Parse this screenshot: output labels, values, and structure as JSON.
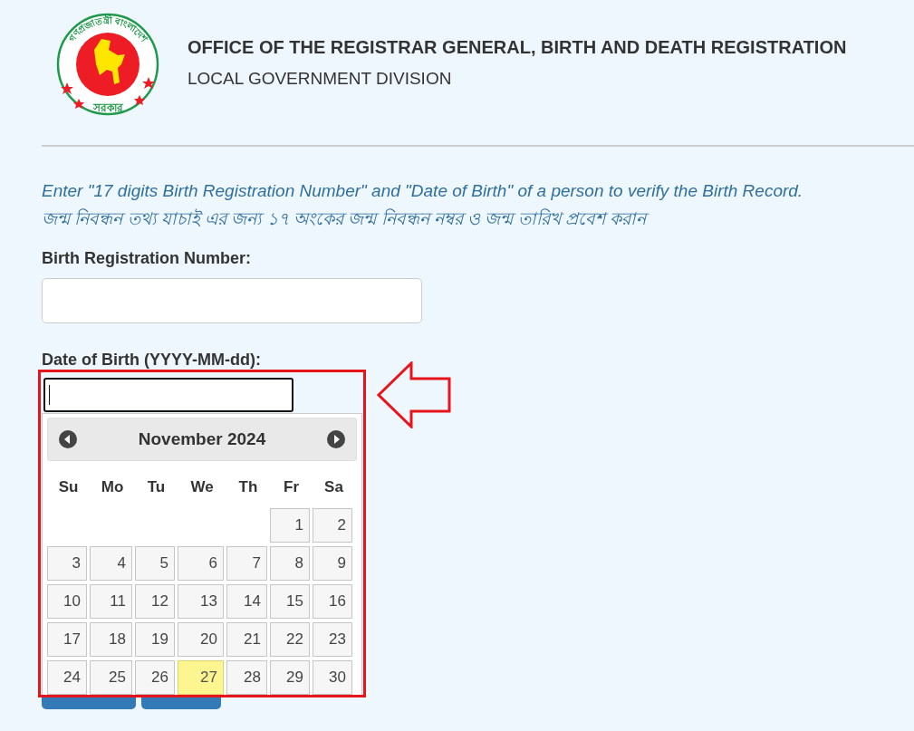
{
  "logo": {
    "top_text": "গণপ্রজাতন্ত্রী বাংলাদেশ",
    "bottom_text": "সরকার"
  },
  "header": {
    "title": "OFFICE OF THE REGISTRAR GENERAL, BIRTH AND DEATH REGISTRATION",
    "subtitle": "LOCAL GOVERNMENT DIVISION"
  },
  "instructions": [
    "Enter \"17 digits Birth Registration Number\" and \"Date of Birth\" of a person to verify the Birth Record.",
    "জন্ম নিবন্ধন তথ্য যাচাই এর জন্য ১৭ অংকের জন্ম নিবন্ধন নম্বর ও জন্ম তারিখ প্রবেশ করান"
  ],
  "fields": [
    {
      "label": "Birth Registration Number:"
    },
    {
      "label": "Date of Birth (YYYY-MM-dd):",
      "focused": true
    }
  ],
  "datepicker": {
    "month_label": "November 2024",
    "weekdays": [
      "Su",
      "Mo",
      "Tu",
      "We",
      "Th",
      "Fr",
      "Sa"
    ],
    "weeks": [
      [
        {
          "kind": "empty"
        },
        {
          "kind": "empty"
        },
        {
          "kind": "empty"
        },
        {
          "kind": "empty"
        },
        {
          "kind": "empty"
        },
        {
          "day": "1",
          "selected": false
        },
        {
          "day": "2",
          "selected": false
        }
      ],
      [
        {
          "day": "3",
          "selected": false
        },
        {
          "day": "4",
          "selected": false
        },
        {
          "day": "5",
          "selected": false
        },
        {
          "day": "6",
          "selected": false
        },
        {
          "day": "7",
          "selected": false
        },
        {
          "day": "8",
          "selected": false
        },
        {
          "day": "9",
          "selected": false
        }
      ],
      [
        {
          "day": "10",
          "selected": false
        },
        {
          "day": "11",
          "selected": false
        },
        {
          "day": "12",
          "selected": false
        },
        {
          "day": "13",
          "selected": false
        },
        {
          "day": "14",
          "selected": false
        },
        {
          "day": "15",
          "selected": false
        },
        {
          "day": "16",
          "selected": false
        }
      ],
      [
        {
          "day": "17",
          "selected": false
        },
        {
          "day": "18",
          "selected": false
        },
        {
          "day": "19",
          "selected": false
        },
        {
          "day": "20",
          "selected": false
        },
        {
          "day": "21",
          "selected": false
        },
        {
          "day": "22",
          "selected": false
        },
        {
          "day": "23",
          "selected": false
        }
      ],
      [
        {
          "day": "24",
          "selected": false
        },
        {
          "day": "25",
          "selected": false
        },
        {
          "day": "26",
          "selected": false
        },
        {
          "day": "27",
          "selected": true
        },
        {
          "day": "28",
          "selected": false
        },
        {
          "day": "29",
          "selected": false
        },
        {
          "day": "30",
          "selected": false
        }
      ]
    ]
  }
}
